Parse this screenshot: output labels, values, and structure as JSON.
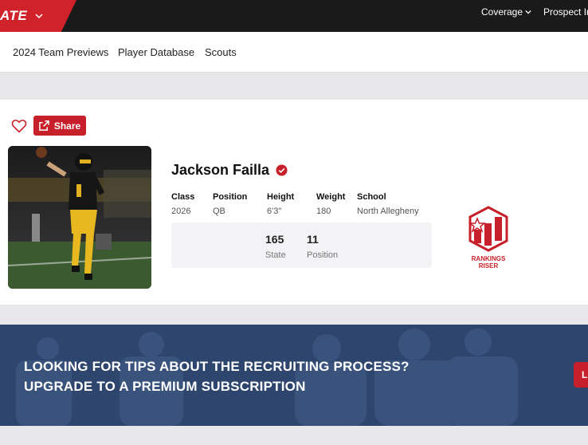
{
  "topbar": {
    "brand_text": "ATE",
    "nav": {
      "coverage_label": "Coverage",
      "prospect_label": "Prospect In"
    }
  },
  "subnav": {
    "items": [
      {
        "label": "2024 Team Previews"
      },
      {
        "label": "Player Database"
      },
      {
        "label": "Scouts"
      }
    ]
  },
  "profile": {
    "share_label": "Share",
    "name": "Jackson Failla",
    "attributes": [
      {
        "label": "Class",
        "value": "2026"
      },
      {
        "label": "Position",
        "value": "QB"
      },
      {
        "label": "Height",
        "value": "6'3\""
      },
      {
        "label": "Weight",
        "value": "180"
      },
      {
        "label": "School",
        "value": "North Allegheny"
      }
    ],
    "rankings": [
      {
        "value": "165",
        "label": "State"
      },
      {
        "value": "11",
        "label": "Position"
      }
    ],
    "badge": {
      "line1": "RANKINGS",
      "line2": "RISER"
    }
  },
  "banner": {
    "line1": "LOOKING FOR TIPS ABOUT THE RECRUITING PROCESS?",
    "line2": "UPGRADE TO A PREMIUM SUBSCRIPTION",
    "button_label": "L"
  },
  "colors": {
    "brand_red": "#c8202a",
    "topbar_bg": "#1a1a1a",
    "banner_bg": "#2e456d"
  }
}
